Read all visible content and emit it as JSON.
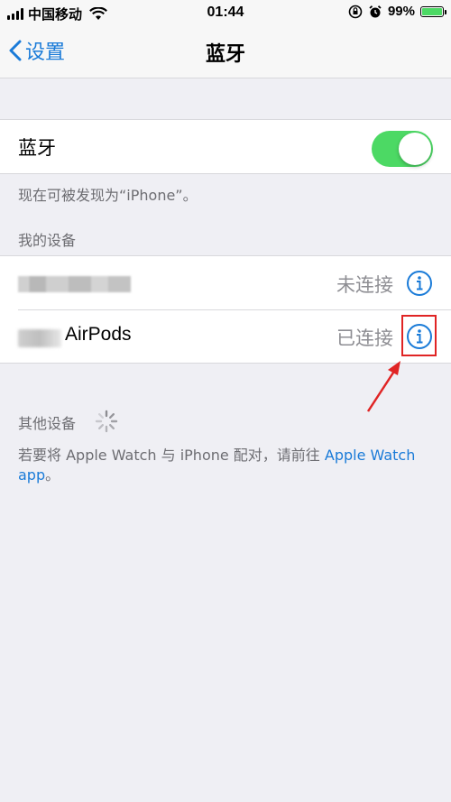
{
  "status_bar": {
    "carrier": "中国移动",
    "time": "01:44",
    "battery_percent": "99%",
    "battery_level": 0.99,
    "battery_color": "#4cd964"
  },
  "nav": {
    "back_label": "设置",
    "title": "蓝牙"
  },
  "bluetooth": {
    "label": "蓝牙",
    "enabled": true,
    "toggle_color": "#4cd964",
    "discoverable_text": "现在可被发现为“iPhone”。"
  },
  "my_devices": {
    "header": "我的设备",
    "devices": [
      {
        "name": "",
        "status": "未连接",
        "name_blurred": true
      },
      {
        "name": "AirPods",
        "status": "已连接",
        "name_prefix_blurred": true,
        "highlighted": true
      }
    ]
  },
  "other_devices": {
    "header": "其他设备",
    "searching": true,
    "pair_text": "若要将 Apple Watch 与 iPhone 配对，请前往 ",
    "pair_link": "Apple Watch app",
    "pair_end": "。"
  },
  "colors": {
    "accent": "#1a7bd8",
    "annotation": "#e02424",
    "background": "#efeff4"
  },
  "icons": [
    "signal-icon",
    "wifi-icon",
    "orientation-lock-icon",
    "alarm-icon",
    "battery-icon",
    "chevron-left-icon",
    "info-icon",
    "spinner-icon",
    "annotation-arrow"
  ]
}
